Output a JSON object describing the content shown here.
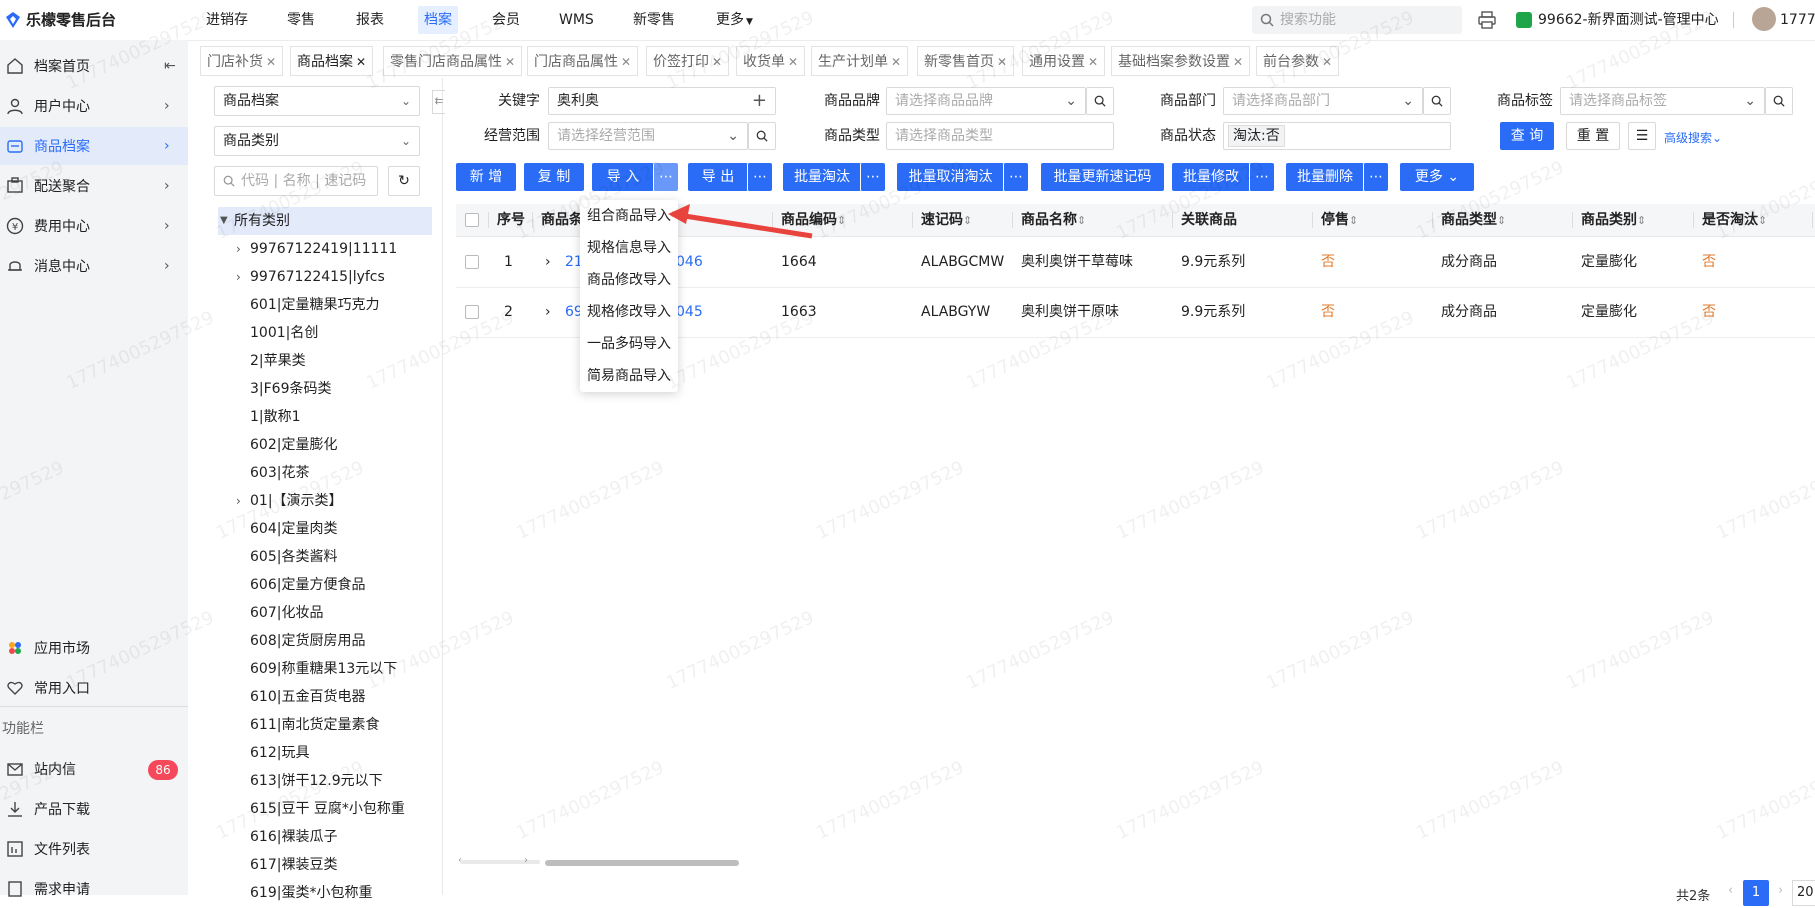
{
  "app": {
    "title": "乐檬零售后台"
  },
  "topnav": [
    "进销存",
    "零售",
    "报表",
    "档案",
    "会员",
    "WMS",
    "新零售",
    "更多"
  ],
  "search": {
    "placeholder": "搜索功能"
  },
  "store": "99662-新界面测试-管理中心",
  "user": "1777",
  "sidebar": {
    "items": [
      {
        "label": "档案首页",
        "icon": "home-icon"
      },
      {
        "label": "用户中心",
        "icon": "user-icon"
      },
      {
        "label": "商品档案",
        "icon": "product-icon"
      },
      {
        "label": "配送聚合",
        "icon": "delivery-icon"
      },
      {
        "label": "费用中心",
        "icon": "yen-icon"
      },
      {
        "label": "消息中心",
        "icon": "bell-icon"
      }
    ],
    "bottom": [
      {
        "label": "应用市场",
        "icon": "app-market-icon"
      },
      {
        "label": "常用入口",
        "icon": "heart-icon"
      }
    ],
    "func_label": "功能栏",
    "func_items": [
      {
        "label": "站内信",
        "icon": "mail-icon",
        "badge": "86"
      },
      {
        "label": "产品下载",
        "icon": "download-icon"
      },
      {
        "label": "文件列表",
        "icon": "file-list-icon"
      },
      {
        "label": "需求申请",
        "icon": "request-icon"
      }
    ]
  },
  "tabs": [
    "门店补货",
    "商品档案",
    "零售门店商品属性",
    "门店商品属性",
    "价签打印",
    "收货单",
    "生产计划单",
    "新零售首页",
    "通用设置",
    "基础档案参数设置",
    "前台参数"
  ],
  "tree": {
    "select1": "商品档案",
    "select2": "商品类别",
    "search_placeholder": "代码 | 名称 | 速记码",
    "root": "所有类别",
    "nodes": [
      "99767122419|11111",
      "99767122415|lyfcs",
      "601|定量糖果巧克力",
      "1001|名创",
      "2|苹果类",
      "3|F69条码类",
      "1|散称1",
      "602|定量膨化",
      "603|花茶",
      "01|【演示类】",
      "604|定量肉类",
      "605|各类酱料",
      "606|定量方便食品",
      "607|化妆品",
      "608|定货厨房用品",
      "609|称重糖果13元以下",
      "610|五金百货电器",
      "611|南北货定量素食",
      "612|玩具",
      "613|饼干12.9元以下",
      "615|豆干 豆腐*小包称重",
      "616|裸装瓜子",
      "617|裸装豆类",
      "619|蛋类*小包称重"
    ]
  },
  "filters": {
    "keyword_label": "关键字",
    "keyword_value": "奥利奥",
    "brand_label": "商品品牌",
    "brand_placeholder": "请选择商品品牌",
    "dept_label": "商品部门",
    "dept_placeholder": "请选择商品部门",
    "tag_label": "商品标签",
    "tag_placeholder": "请选择商品标签",
    "scope_label": "经营范围",
    "scope_placeholder": "请选择经营范围",
    "type_label": "商品类型",
    "type_placeholder": "请选择商品类型",
    "status_label": "商品状态",
    "status_value": "淘汰:否",
    "query": "查 询",
    "reset": "重 置",
    "advanced": "高级搜索"
  },
  "toolbar": {
    "add": "新 增",
    "copy": "复 制",
    "import": "导 入",
    "export": "导 出",
    "batch_obsolete": "批量淘汰",
    "batch_cancel_obsolete": "批量取消淘汰",
    "batch_update_code": "批量更新速记码",
    "batch_modify": "批量修改",
    "batch_delete": "批量删除",
    "more": "更多"
  },
  "table": {
    "headers": [
      "序号",
      "商品条",
      "商品编码",
      "速记码",
      "商品名称",
      "关联商品",
      "停售",
      "商品类型",
      "商品类别",
      "是否淘汰"
    ],
    "rows": [
      {
        "index": "1",
        "barcode_a": "21",
        "barcode_b": "046",
        "code": "1664",
        "quick": "ALABGCMW",
        "name": "奥利奥饼干草莓味",
        "related": "9.9元系列",
        "stop": "否",
        "type": "成分商品",
        "category": "定量膨化",
        "obsolete": "否"
      },
      {
        "index": "2",
        "barcode_a": "69",
        "barcode_b": "045",
        "code": "1663",
        "quick": "ALABGYW",
        "name": "奥利奥饼干原味",
        "related": "9.9元系列",
        "stop": "否",
        "type": "成分商品",
        "category": "定量膨化",
        "obsolete": "否"
      }
    ]
  },
  "import_menu": [
    "组合商品导入",
    "规格信息导入",
    "商品修改导入",
    "规格修改导入",
    "一品多码导入",
    "简易商品导入"
  ],
  "pager": {
    "total": "共2条",
    "current": "1",
    "size": "20"
  },
  "watermark": "17774005297529"
}
